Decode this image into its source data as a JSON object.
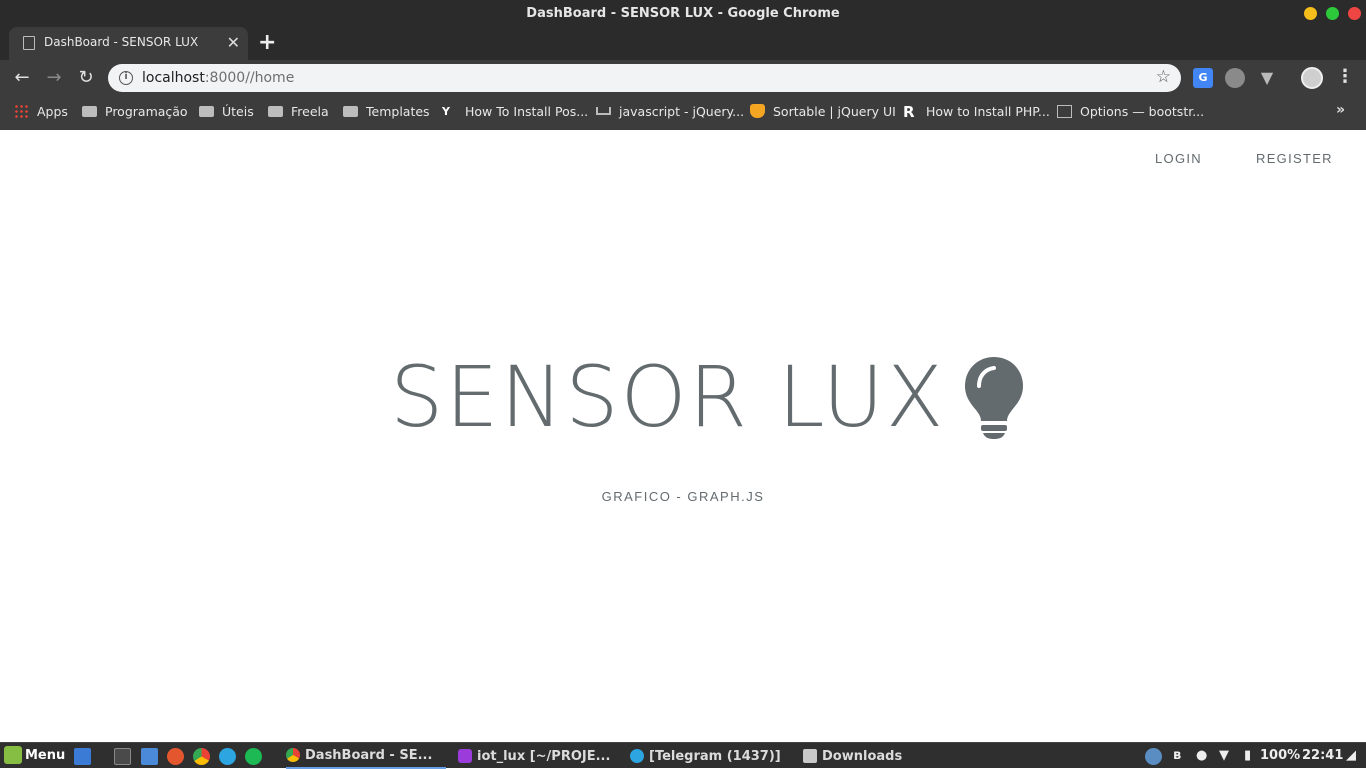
{
  "window": {
    "title": "DashBoard - SENSOR LUX - Google Chrome"
  },
  "tab": {
    "title": "DashBoard - SENSOR LUX",
    "close": "✕",
    "new": "+"
  },
  "toolbar": {
    "url_host": "localhost",
    "url_rest": ":8000//home",
    "star": "☆",
    "translate_label": "G"
  },
  "bookmarks": [
    {
      "label": "Apps",
      "icon": "apps-grid-icon"
    },
    {
      "label": "Programação",
      "icon": "folder-icon"
    },
    {
      "label": "Úteis",
      "icon": "folder-icon"
    },
    {
      "label": "Freela",
      "icon": "folder-icon"
    },
    {
      "label": "Templates",
      "icon": "folder-icon"
    },
    {
      "label": "How To Install Pos...",
      "icon": "yoast-icon"
    },
    {
      "label": "javascript - jQuery...",
      "icon": "stackoverflow-icon"
    },
    {
      "label": "Sortable | jQuery UI",
      "icon": "jquery-ui-icon"
    },
    {
      "label": "How to Install PHP...",
      "icon": "r-logo-icon"
    },
    {
      "label": "Options — bootstr...",
      "icon": "document-icon"
    }
  ],
  "page": {
    "nav": {
      "login": "LOGIN",
      "register": "REGISTER"
    },
    "title": "SENSOR LUX",
    "subtitle": "GRAFICO - GRAPH.JS"
  },
  "taskbar": {
    "menu": "Menu",
    "tasks": [
      {
        "label": "DashBoard - SE...",
        "active": true
      },
      {
        "label": "iot_lux [~/PROJE...",
        "active": false
      },
      {
        "label": "[Telegram (1437)]",
        "active": false
      },
      {
        "label": "Downloads",
        "active": false
      }
    ],
    "battery": "100%",
    "clock": "22:41"
  },
  "colors": {
    "accent_text": "#636b6f",
    "chrome_dark": "#3c3c3c",
    "titlebar": "#2b2b2b"
  }
}
